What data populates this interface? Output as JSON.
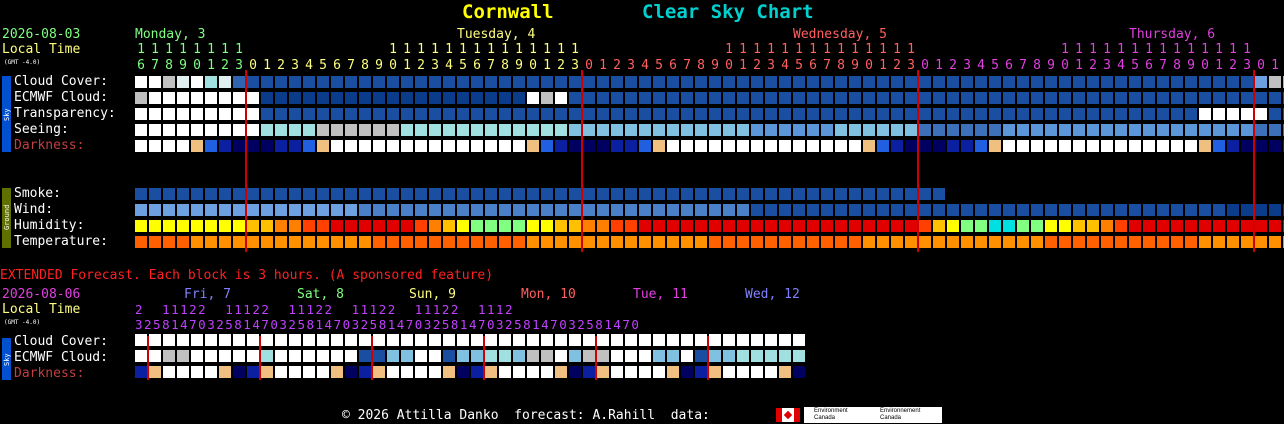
{
  "title": {
    "location": "Cornwall",
    "name": "Clear Sky Chart"
  },
  "header": {
    "date": "2026-08-03",
    "local_time_label": "Local Time",
    "gmt": "(GMT -4.0)",
    "days": [
      {
        "label": "Monday, 3",
        "color": "#80ff80"
      },
      {
        "label": "Tuesday, 4",
        "color": "#ffff80"
      },
      {
        "label": "Wednesday, 5",
        "color": "#ff6060"
      },
      {
        "label": "Thursday, 6",
        "color": "#e040e0"
      }
    ],
    "hours": [
      16,
      17,
      18,
      19,
      20,
      21,
      22,
      23,
      0,
      1,
      2,
      3,
      4,
      5,
      6,
      7,
      8,
      9,
      10,
      11,
      12,
      13,
      14,
      15,
      16,
      17,
      18,
      19,
      20,
      21,
      22,
      23,
      0,
      1,
      2,
      3,
      4,
      5,
      6,
      7,
      8,
      9,
      10,
      11,
      12,
      13,
      14,
      15,
      16,
      17,
      18,
      19,
      20,
      21,
      22,
      23,
      0,
      1,
      2,
      3,
      4,
      5,
      6,
      7,
      8,
      9,
      10,
      11,
      12,
      13,
      14,
      15,
      16,
      17,
      18,
      19,
      20,
      21,
      22,
      23,
      0,
      1,
      2,
      3,
      4,
      5,
      6,
      7,
      8,
      9,
      10,
      11,
      12,
      13,
      14,
      15,
      16,
      17,
      18,
      19,
      20
    ]
  },
  "sky_group_label": "Sky",
  "ground_group_label": "Ground",
  "rows": {
    "cloud_cover": {
      "label": "Cloud Cover:"
    },
    "ecmwf_cloud": {
      "label": "ECMWF Cloud:"
    },
    "transparency": {
      "label": "Transparency:"
    },
    "seeing": {
      "label": "Seeing:"
    },
    "darkness": {
      "label": "Darkness:"
    },
    "smoke": {
      "label": "Smoke:"
    },
    "wind": {
      "label": "Wind:"
    },
    "humidity": {
      "label": "Humidity:"
    },
    "temperature": {
      "label": "Temperature:"
    }
  },
  "extended": {
    "banner": "EXTENDED Forecast. Each block is 3 hours. (A sponsored feature)",
    "date": "2026-08-06",
    "local_time_label": "Local Time",
    "gmt": "(GMT -4.0)",
    "hour_tens": "2  11122  11122  11122  11122  11122  1112",
    "hour_ones": "32581470325814703258147032581470325814703258147032581470",
    "days": [
      {
        "label": "Fri, 7",
        "color": "#8080ff"
      },
      {
        "label": "Sat, 8",
        "color": "#80ff80"
      },
      {
        "label": "Sun, 9",
        "color": "#ffff80"
      },
      {
        "label": "Mon, 10",
        "color": "#ff6060"
      },
      {
        "label": "Tue, 11",
        "color": "#e040e0"
      },
      {
        "label": "Wed, 12",
        "color": "#8080ff"
      }
    ],
    "rows": {
      "cloud_cover": {
        "label": "Cloud Cover:"
      },
      "ecmwf_cloud": {
        "label": "ECMWF Cloud:"
      },
      "darkness": {
        "label": "Darkness:"
      }
    }
  },
  "footer": {
    "text": "© 2026 Attilla Danko  forecast: A.Rahill  data:",
    "org1": "Environment\nCanada",
    "org2": "Environnement\nCanada"
  },
  "colors": {
    "cloud_palette": [
      "#ffffff",
      "#e0f0f0",
      "#c0c0c0",
      "#a0e0e0",
      "#80c0e0",
      "#6ca0e0",
      "#4a80c8",
      "#2e64b0",
      "#1a4ea0",
      "#0a3c8a",
      "#003070"
    ],
    "seeing_palette": [
      "#ffffff",
      "#c0c0c0",
      "#a0e0e0",
      "#80c0e0",
      "#5a96d8",
      "#3c70b8",
      "#1e4c96",
      "#0a3070"
    ],
    "temp_hot": "#ff6000",
    "temp_warm": "#ff9000",
    "red_line": "#d00000"
  },
  "chart_data": {
    "type": "heatmap",
    "title": "Clear Sky Chart",
    "hours": 101,
    "midnight_indices": [
      8,
      32,
      56,
      80
    ],
    "series": [
      {
        "name": "Cloud Cover",
        "values": [
          0,
          0,
          2,
          1,
          0,
          3,
          1,
          7,
          8,
          8,
          8,
          8,
          8,
          8,
          8,
          8,
          8,
          8,
          8,
          8,
          8,
          8,
          8,
          8,
          8,
          8,
          8,
          8,
          8,
          8,
          8,
          8,
          8,
          8,
          8,
          8,
          8,
          8,
          8,
          8,
          8,
          8,
          8,
          8,
          8,
          8,
          8,
          8,
          8,
          8,
          8,
          8,
          8,
          8,
          8,
          8,
          8,
          8,
          8,
          8,
          8,
          8,
          8,
          8,
          8,
          8,
          8,
          8,
          8,
          8,
          8,
          8,
          8,
          8,
          8,
          8,
          8,
          8,
          8,
          8,
          5,
          2,
          4,
          5,
          5,
          4,
          4,
          4,
          2,
          2,
          2,
          2,
          0,
          4,
          4,
          2,
          2,
          0,
          2,
          0,
          0
        ]
      },
      {
        "name": "ECMWF Cloud",
        "values": [
          2,
          0,
          0,
          0,
          0,
          0,
          0,
          0,
          0,
          9,
          9,
          9,
          9,
          9,
          9,
          9,
          9,
          9,
          9,
          9,
          9,
          9,
          9,
          9,
          9,
          9,
          9,
          9,
          0,
          2,
          0,
          8,
          8,
          8,
          8,
          8,
          8,
          8,
          8,
          8,
          8,
          8,
          8,
          8,
          8,
          8,
          8,
          8,
          8,
          8,
          8,
          8,
          8,
          8,
          8,
          8,
          8,
          8,
          8,
          8,
          8,
          8,
          8,
          8,
          8,
          8,
          8,
          8,
          8,
          8,
          8,
          8,
          8,
          8,
          8,
          8,
          8,
          8,
          8,
          8,
          8,
          8,
          8,
          8,
          8,
          8,
          8,
          0,
          0,
          0,
          0,
          0,
          0,
          0,
          0,
          0,
          0,
          0,
          0,
          0,
          0
        ]
      },
      {
        "name": "Transparency",
        "values": [
          0,
          0,
          0,
          0,
          0,
          0,
          0,
          0,
          0,
          8,
          8,
          8,
          8,
          8,
          8,
          8,
          8,
          8,
          8,
          8,
          8,
          8,
          8,
          8,
          8,
          8,
          8,
          8,
          8,
          8,
          8,
          8,
          8,
          8,
          8,
          8,
          8,
          8,
          8,
          8,
          8,
          8,
          8,
          8,
          8,
          8,
          8,
          8,
          8,
          8,
          8,
          8,
          8,
          8,
          8,
          8,
          8,
          8,
          8,
          8,
          8,
          8,
          8,
          8,
          8,
          8,
          8,
          8,
          8,
          8,
          8,
          8,
          8,
          8,
          8,
          8,
          0,
          0,
          0,
          0,
          0,
          8,
          8,
          0,
          0,
          0,
          0,
          0,
          0,
          0,
          0,
          0,
          0,
          0,
          0,
          0,
          0,
          0,
          0,
          0,
          0
        ]
      },
      {
        "name": "Seeing",
        "values": [
          0,
          0,
          0,
          0,
          0,
          0,
          0,
          0,
          0,
          2,
          2,
          2,
          2,
          1,
          1,
          1,
          1,
          1,
          1,
          2,
          2,
          2,
          2,
          2,
          2,
          2,
          2,
          2,
          2,
          2,
          2,
          3,
          3,
          3,
          3,
          3,
          3,
          3,
          3,
          3,
          3,
          3,
          3,
          3,
          4,
          4,
          4,
          4,
          4,
          4,
          3,
          3,
          3,
          3,
          3,
          3,
          5,
          5,
          5,
          5,
          5,
          5,
          4,
          4,
          4,
          4,
          4,
          4,
          4,
          4,
          4,
          4,
          4,
          4,
          4,
          4,
          4,
          4,
          4,
          4,
          5,
          5,
          5,
          5,
          5,
          5,
          5,
          1,
          1,
          1,
          1,
          6,
          6,
          6,
          6,
          3,
          3,
          3,
          0,
          0,
          0
        ]
      },
      {
        "name": "Humidity",
        "values": [
          60,
          60,
          60,
          60,
          60,
          60,
          60,
          60,
          65,
          70,
          75,
          80,
          85,
          90,
          95,
          95,
          95,
          95,
          95,
          95,
          85,
          75,
          65,
          55,
          50,
          45,
          45,
          50,
          55,
          60,
          65,
          70,
          75,
          80,
          85,
          90,
          95,
          95,
          95,
          95,
          95,
          95,
          95,
          95,
          95,
          95,
          95,
          95,
          95,
          95,
          95,
          95,
          95,
          95,
          95,
          95,
          85,
          70,
          55,
          50,
          45,
          40,
          40,
          45,
          50,
          55,
          60,
          65,
          70,
          80,
          90,
          95,
          95,
          95,
          95,
          95,
          95,
          95,
          95,
          95,
          95,
          95,
          95,
          95,
          95,
          95,
          95,
          95,
          95,
          85,
          75,
          65,
          60,
          60,
          60,
          60,
          60,
          60,
          60,
          60,
          60
        ]
      }
    ]
  }
}
